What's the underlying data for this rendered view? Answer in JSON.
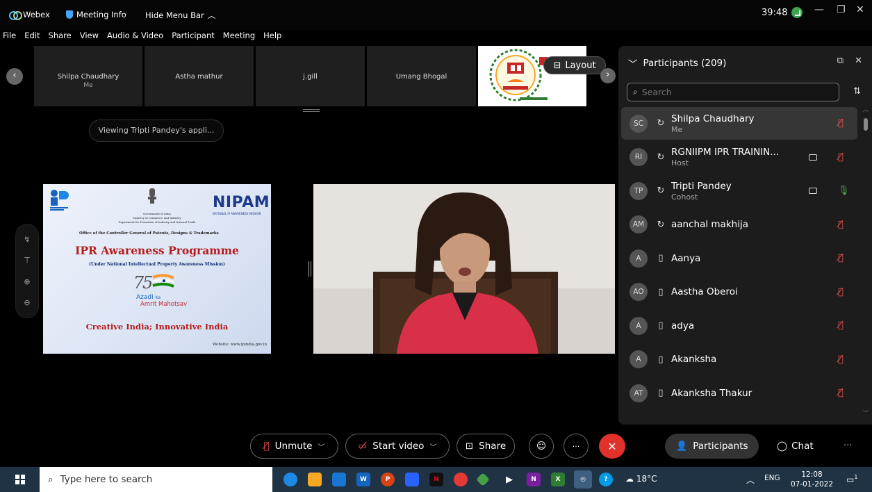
{
  "titlebar": {
    "app": "Webex",
    "meeting_info": "Meeting Info",
    "hide_menu": "Hide Menu Bar",
    "timer": "39:48"
  },
  "menu": [
    "File",
    "Edit",
    "Share",
    "View",
    "Audio & Video",
    "Participant",
    "Meeting",
    "Help"
  ],
  "filmstrip": {
    "tiles": [
      {
        "name": "Shilpa Chaudhary",
        "sub": "Me"
      },
      {
        "name": "Astha mathur",
        "sub": ""
      },
      {
        "name": "j.gill",
        "sub": ""
      },
      {
        "name": "Umang Bhogal",
        "sub": ""
      }
    ],
    "layout_label": "Layout"
  },
  "viewing_label": "Viewing Tripti Pandey's appli...",
  "slide": {
    "nipam": "NIPAM",
    "nipam_sub": "NATIONAL IP AWARENESS MISSION",
    "gov_lines": [
      "Government of India",
      "Ministry of Commerce and Industry",
      "Department for Promotion of Industry and Internal Trade"
    ],
    "office": "Office of the Controller General of Patents, Designs & Trademarks",
    "title": "IPR Awareness Programme",
    "mission": "(Under National Intellectual Property Awareness Mission)",
    "azadi": "Azadi",
    "ka": "Ka",
    "amrit": "Amrit Mahotsav",
    "tagline": "Creative India; Innovative India",
    "website": "Website: www.ipindia.gov.in"
  },
  "panel": {
    "title": "Participants (209)",
    "search_placeholder": "Search",
    "participants": [
      {
        "initials": "SC",
        "name": "Shilpa Chaudhary",
        "role": "Me",
        "device": "sync",
        "camera": false,
        "mic": "muted",
        "active": true
      },
      {
        "initials": "RI",
        "name": "RGNIIPM IPR TRAININ...",
        "role": "Host",
        "device": "sync",
        "camera": true,
        "mic": "muted",
        "active": false
      },
      {
        "initials": "TP",
        "name": "Tripti Pandey",
        "role": "Cohost",
        "device": "sync",
        "camera": true,
        "mic": "on",
        "active": false
      },
      {
        "initials": "AM",
        "name": "aanchal makhija",
        "role": "",
        "device": "sync",
        "camera": false,
        "mic": "muted",
        "active": false
      },
      {
        "initials": "A",
        "name": "Aanya",
        "role": "",
        "device": "mobile",
        "camera": false,
        "mic": "muted",
        "active": false
      },
      {
        "initials": "AO",
        "name": "Aastha Oberoi",
        "role": "",
        "device": "mobile",
        "camera": false,
        "mic": "muted",
        "active": false
      },
      {
        "initials": "A",
        "name": "adya",
        "role": "",
        "device": "mobile",
        "camera": false,
        "mic": "muted",
        "active": false
      },
      {
        "initials": "A",
        "name": "Akanksha",
        "role": "",
        "device": "mobile",
        "camera": false,
        "mic": "muted",
        "active": false
      },
      {
        "initials": "AT",
        "name": "Akanksha Thakur",
        "role": "",
        "device": "mobile",
        "camera": false,
        "mic": "muted",
        "active": false
      }
    ]
  },
  "controls": {
    "unmute": "Unmute",
    "start_video": "Start video",
    "share": "Share",
    "participants": "Participants",
    "chat": "Chat"
  },
  "taskbar": {
    "search_placeholder": "Type here to search",
    "weather": "18°C",
    "lang": "ENG",
    "time": "12:08",
    "date": "07-01-2022",
    "notifications": "1"
  },
  "colors": {
    "muted_mic": "#f05252",
    "active_mic": "#4caf50",
    "end_call": "#e0312b",
    "taskbar": "#1f3345"
  }
}
